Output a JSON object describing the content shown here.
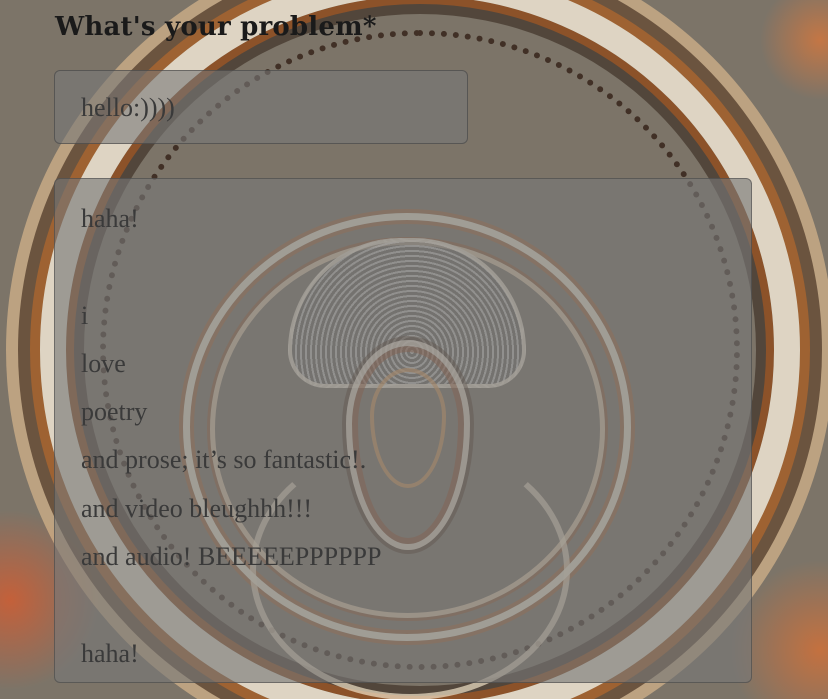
{
  "form": {
    "problem_label": "What's your problem*",
    "input_value": "hello:))))",
    "textarea_lines": [
      "haha!",
      "",
      "i",
      "love",
      "poetry",
      "and prose; it’s so fantastic!.",
      "and video bleughhh!!!",
      "and audio! BEEEEEPPPPPP",
      "",
      "haha!"
    ]
  },
  "colors": {
    "field_fill": "#787878",
    "label_text": "#1a1a1a",
    "field_text": "#3a3a3a"
  },
  "background": {
    "icon": "psychedelic-rings-artwork"
  }
}
